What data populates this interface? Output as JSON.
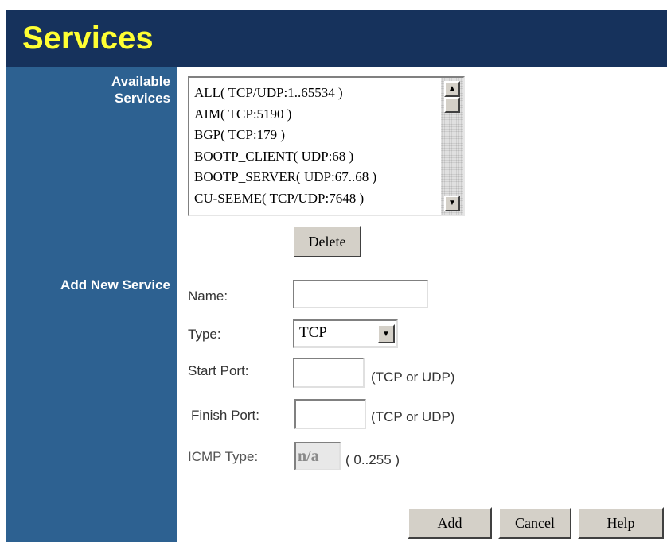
{
  "header": {
    "title": "Services"
  },
  "sidebar": {
    "available_services_label_line1": "Available",
    "available_services_label_line2": "Services",
    "add_new_service_label": "Add New Service"
  },
  "services_list": {
    "items": [
      "ALL( TCP/UDP:1..65534 )",
      "AIM( TCP:5190 )",
      "BGP( TCP:179 )",
      "BOOTP_CLIENT( UDP:68 )",
      "BOOTP_SERVER( UDP:67..68 )",
      "CU-SEEME( TCP/UDP:7648 )"
    ]
  },
  "buttons": {
    "delete": "Delete",
    "add": "Add",
    "cancel": "Cancel",
    "help": "Help"
  },
  "form": {
    "name_label": "Name:",
    "name_value": "",
    "type_label": "Type:",
    "type_value": "TCP",
    "start_port_label": "Start Port:",
    "start_port_value": "",
    "start_port_hint": "(TCP or UDP)",
    "finish_port_label": "Finish Port:",
    "finish_port_value": "",
    "finish_port_hint": "(TCP or UDP)",
    "icmp_type_label": "ICMP Type:",
    "icmp_type_value": "n/a",
    "icmp_type_hint": "( 0..255 )"
  },
  "icons": {
    "scroll_up": "scroll-up-arrow-icon",
    "scroll_down": "scroll-down-arrow-icon",
    "dropdown": "chevron-down-icon"
  },
  "colors": {
    "header_bg": "#16325c",
    "title_text": "#ffff33",
    "sidebar_bg": "#2d6191",
    "button_face": "#d4d0c8"
  }
}
